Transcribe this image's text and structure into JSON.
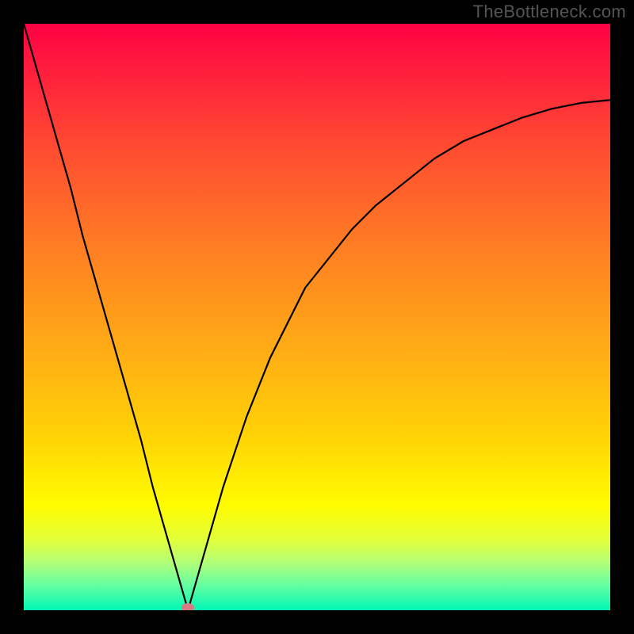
{
  "watermark": "TheBottleneck.com",
  "colors": {
    "frame": "#000000",
    "curve": "#000000",
    "dot": "#d87a84",
    "gradient_top": "#ff0043",
    "gradient_bottom": "#00f7b6"
  },
  "chart_data": {
    "type": "line",
    "title": "",
    "xlabel": "",
    "ylabel": "",
    "xlim": [
      0,
      100
    ],
    "ylim": [
      0,
      100
    ],
    "grid": false,
    "legend": false,
    "annotations": [],
    "min_marker": {
      "x": 28,
      "y": 0
    },
    "x": [
      0,
      2,
      4,
      6,
      8,
      10,
      12,
      14,
      16,
      18,
      20,
      22,
      24,
      26,
      28,
      30,
      32,
      34,
      36,
      38,
      40,
      42,
      45,
      48,
      52,
      56,
      60,
      65,
      70,
      75,
      80,
      85,
      90,
      95,
      100
    ],
    "y": [
      100,
      93,
      86,
      79,
      72,
      64,
      57,
      50,
      43,
      36,
      29,
      21,
      14,
      7,
      0,
      7,
      14,
      21,
      27,
      33,
      38,
      43,
      49,
      55,
      60,
      65,
      69,
      73,
      77,
      80,
      82,
      84,
      85.5,
      86.5,
      87
    ]
  }
}
